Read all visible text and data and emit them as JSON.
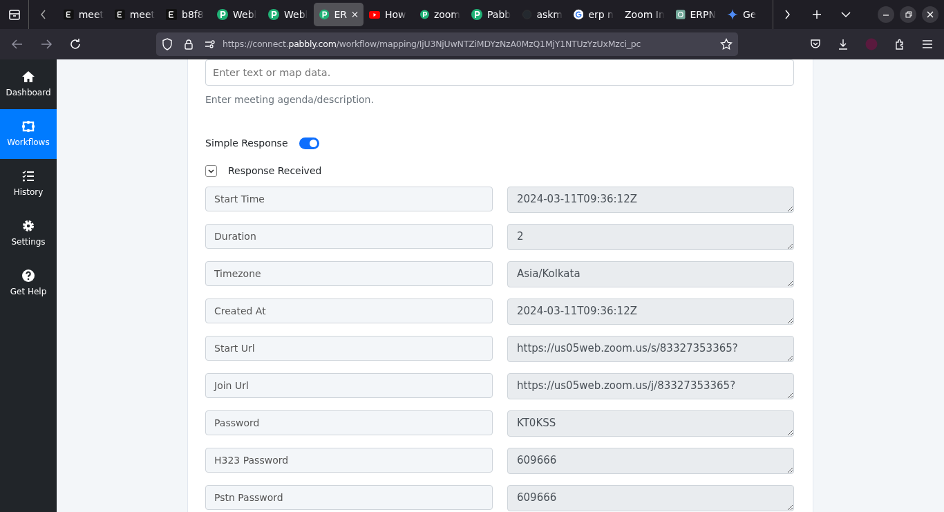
{
  "browser": {
    "tabs": [
      {
        "title": "meet",
        "selected": false
      },
      {
        "title": "meet",
        "selected": false
      },
      {
        "title": "b8f8",
        "selected": false
      },
      {
        "title": "Webl",
        "selected": false
      },
      {
        "title": "Webl",
        "selected": false
      },
      {
        "title": "ER",
        "selected": true
      },
      {
        "title": "How",
        "selected": false
      },
      {
        "title": "zoom",
        "selected": false
      },
      {
        "title": "Pabb",
        "selected": false
      },
      {
        "title": "askm",
        "selected": false
      },
      {
        "title": "erp n",
        "selected": false
      },
      {
        "title": "Zoom In",
        "selected": false
      },
      {
        "title": "ERPN",
        "selected": false
      },
      {
        "title": "Ge",
        "selected": false
      }
    ],
    "url": {
      "scheme": "https://connect.",
      "domain": "pabbly.com",
      "path": "/workflow/mapping/IjU3NjUwNTZiMDYzNzA0MzQ1MjY1NTUzYzUxMzci_pc"
    }
  },
  "sidebar": {
    "items": [
      {
        "label": "Dashboard",
        "selected": false
      },
      {
        "label": "Workflows",
        "selected": true
      },
      {
        "label": "History",
        "selected": false
      },
      {
        "label": "Settings",
        "selected": false
      },
      {
        "label": "Get Help",
        "selected": false
      }
    ]
  },
  "form": {
    "agenda": {
      "placeholder": "Enter text or map data.",
      "help": "Enter meeting agenda/description."
    },
    "simple_response": {
      "label": "Simple Response",
      "on": true
    },
    "response": {
      "label": "Response Received",
      "expanded": true,
      "rows": [
        {
          "label": "Start Time",
          "value": "2024-03-11T09:36:12Z"
        },
        {
          "label": "Duration",
          "value": "2"
        },
        {
          "label": "Timezone",
          "value": "Asia/Kolkata"
        },
        {
          "label": "Created At",
          "value": "2024-03-11T09:36:12Z"
        },
        {
          "label": "Start Url",
          "value": "https://us05web.zoom.us/s/83327353365?"
        },
        {
          "label": "Join Url",
          "value": "https://us05web.zoom.us/j/83327353365?"
        },
        {
          "label": "Password",
          "value": "KT0KSS"
        },
        {
          "label": "H323 Password",
          "value": "609666"
        },
        {
          "label": "Pstn Password",
          "value": "609666"
        }
      ]
    }
  }
}
